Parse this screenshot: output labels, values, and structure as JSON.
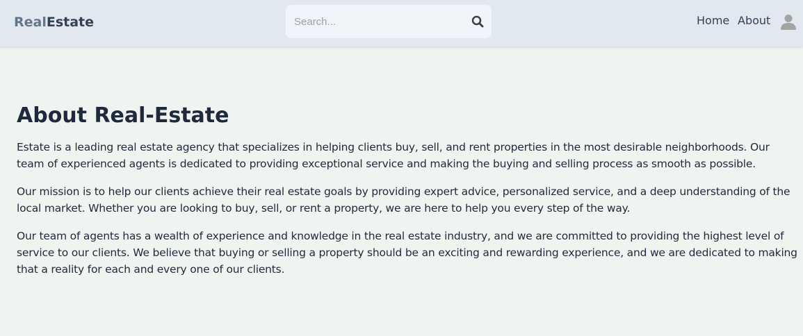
{
  "header": {
    "logo_part1": "Real",
    "logo_part2": "Estate",
    "search": {
      "placeholder": "Search...",
      "value": ""
    },
    "nav": {
      "home": "Home",
      "about": "About"
    }
  },
  "main": {
    "title": "About Real-Estate",
    "paragraphs": [
      "Estate is a leading real estate agency that specializes in helping clients buy, sell, and rent properties in the most desirable neighborhoods. Our team of experienced agents is dedicated to providing exceptional service and making the buying and selling process as smooth as possible.",
      "Our mission is to help our clients achieve their real estate goals by providing expert advice, personalized service, and a deep understanding of the local market. Whether you are looking to buy, sell, or rent a property, we are here to help you every step of the way.",
      "Our team of agents has a wealth of experience and knowledge in the real estate industry, and we are committed to providing the highest level of service to our clients. We believe that buying or selling a property should be an exciting and rewarding experience, and we are dedicated to making that a reality for each and every one of our clients."
    ]
  },
  "icons": {
    "search": "search-icon",
    "avatar": "user-avatar-icon"
  },
  "colors": {
    "header_bg": "#e2e8f0",
    "page_bg": "#f0f4f1",
    "logo_real": "#64748b",
    "logo_estate": "#334155",
    "text": "#1e293b"
  }
}
